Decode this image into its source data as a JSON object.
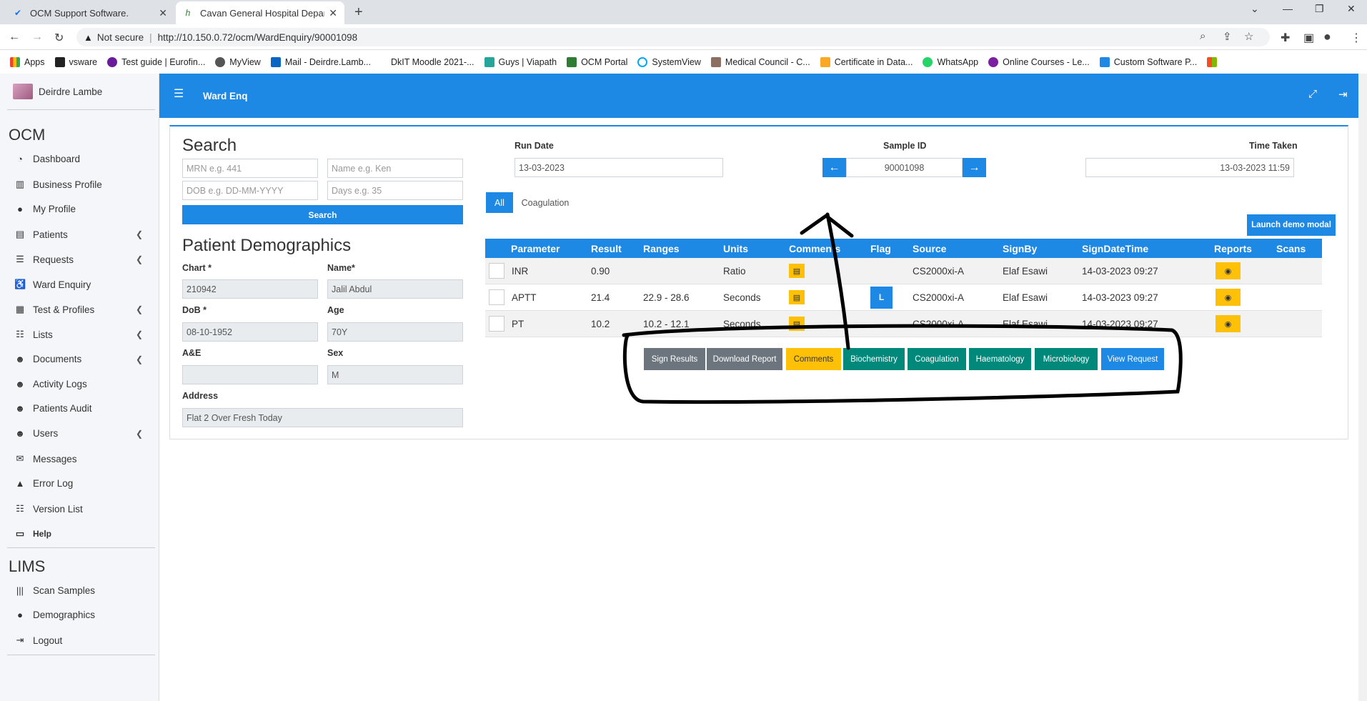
{
  "browser": {
    "tabs": [
      {
        "title": "OCM Support Software."
      },
      {
        "title": "Cavan General Hospital Departm"
      }
    ],
    "security_label": "Not secure",
    "url": "http://10.150.0.72/ocm/WardEnquiry/90001098",
    "bookmarks": [
      "Apps",
      "vsware",
      "Test guide | Eurofin...",
      "MyView",
      "Mail - Deirdre.Lamb...",
      "DkIT Moodle 2021-...",
      "Guys | Viapath",
      "OCM Portal",
      "SystemView",
      "Medical Council - C...",
      "Certificate in Data...",
      "WhatsApp",
      "Online Courses - Le...",
      "Custom Software P..."
    ]
  },
  "sidebar": {
    "user_name": "Deirdre Lambe",
    "section_ocm": "OCM",
    "ocm_items": [
      {
        "label": "Dashboard",
        "icon": "dashboard-icon"
      },
      {
        "label": "Business Profile",
        "icon": "building-icon"
      },
      {
        "label": "My Profile",
        "icon": "user-icon"
      },
      {
        "label": "Patients",
        "icon": "id-card-icon"
      },
      {
        "label": "Requests",
        "icon": "database-icon"
      },
      {
        "label": "Ward Enquiry",
        "icon": "wheelchair-icon"
      },
      {
        "label": "Test & Profiles",
        "icon": "tests-icon"
      },
      {
        "label": "Lists",
        "icon": "list-icon"
      },
      {
        "label": "Documents",
        "icon": "users-icon"
      },
      {
        "label": "Activity Logs",
        "icon": "logs-icon"
      },
      {
        "label": "Patients Audit",
        "icon": "audit-icon"
      },
      {
        "label": "Users",
        "icon": "users-icon"
      },
      {
        "label": "Messages",
        "icon": "envelope-icon"
      },
      {
        "label": "Error Log",
        "icon": "warning-icon"
      },
      {
        "label": "Version List",
        "icon": "list-icon"
      },
      {
        "label": "Help",
        "icon": "help-icon"
      }
    ],
    "section_lims": "LIMS",
    "lims_items": [
      {
        "label": "Scan Samples",
        "icon": "barcode-icon"
      },
      {
        "label": "Demographics",
        "icon": "user-icon"
      },
      {
        "label": "Logout",
        "icon": "logout-icon"
      }
    ]
  },
  "topbar": {
    "title": "Ward Enq"
  },
  "search": {
    "heading": "Search",
    "mrn_placeholder": "MRN e.g. 441",
    "name_placeholder": "Name e.g. Ken",
    "dob_placeholder": "DOB e.g. DD-MM-YYYY",
    "days_placeholder": "Days e.g. 35",
    "button": "Search"
  },
  "demographics": {
    "heading": "Patient Demographics",
    "chart_label": "Chart *",
    "chart_value": "210942",
    "name_label": "Name*",
    "name_value": "Jalil Abdul",
    "dob_label": "DoB *",
    "dob_value": "08-10-1952",
    "age_label": "Age",
    "age_value": "70Y",
    "ae_label": "A&E",
    "ae_value": "",
    "sex_label": "Sex",
    "sex_value": "M",
    "address_label": "Address",
    "address_value": "Flat 2 Over Fresh Today"
  },
  "sample": {
    "run_date_label": "Run Date",
    "run_date_value": "13-03-2023",
    "sample_id_label": "Sample ID",
    "sample_id_value": "90001098",
    "time_taken_label": "Time Taken",
    "time_taken_value": "13-03-2023 11:59"
  },
  "filter_tabs": [
    "All",
    "Coagulation"
  ],
  "launch_button": "Launch demo modal",
  "results": {
    "columns": [
      "Parameter",
      "Result",
      "Ranges",
      "Units",
      "Comments",
      "Flag",
      "Source",
      "SignBy",
      "SignDateTime",
      "Reports",
      "Scans"
    ],
    "rows": [
      {
        "parameter": "INR",
        "result": "0.90",
        "ranges": "",
        "units": "Ratio",
        "flag": "",
        "source": "CS2000xi-A",
        "signby": "Elaf Esawi",
        "signdatetime": "14-03-2023 09:27"
      },
      {
        "parameter": "APTT",
        "result": "21.4",
        "ranges": "22.9 - 28.6",
        "units": "Seconds",
        "flag": "L",
        "source": "CS2000xi-A",
        "signby": "Elaf Esawi",
        "signdatetime": "14-03-2023 09:27"
      },
      {
        "parameter": "PT",
        "result": "10.2",
        "ranges": "10.2 - 12.1",
        "units": "Seconds",
        "flag": "",
        "source": "CS2000xi-A",
        "signby": "Elaf Esawi",
        "signdatetime": "14-03-2023 09:27"
      }
    ]
  },
  "actions": [
    {
      "label": "Sign Results",
      "color": "#6c757d"
    },
    {
      "label": "Download Report",
      "color": "#6c757d"
    },
    {
      "label": "Comments",
      "color": "#ffc107"
    },
    {
      "label": "Biochemistry",
      "color": "#00897b"
    },
    {
      "label": "Coagulation",
      "color": "#00897b"
    },
    {
      "label": "Haematology",
      "color": "#00897b"
    },
    {
      "label": "Microbiology",
      "color": "#00897b"
    },
    {
      "label": "View Request",
      "color": "#1e88e5"
    }
  ]
}
